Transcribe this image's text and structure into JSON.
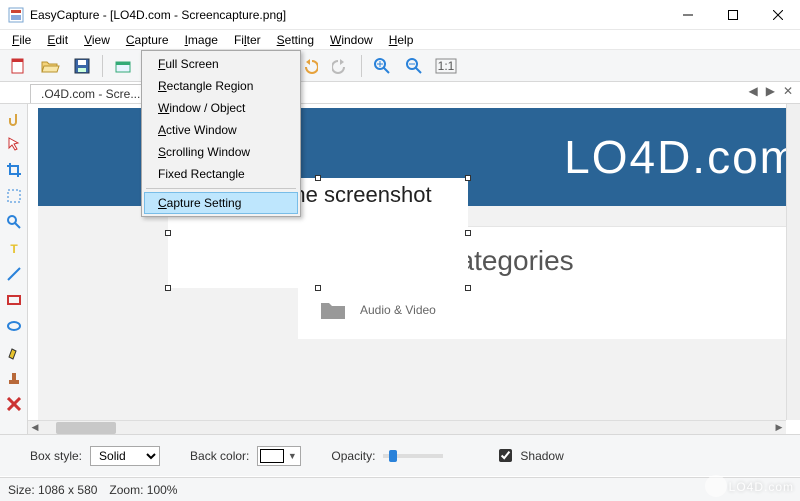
{
  "window": {
    "title": "EasyCapture - [LO4D.com - Screencapture.png]"
  },
  "menubar": [
    "File",
    "Edit",
    "View",
    "Capture",
    "Image",
    "Filter",
    "Setting",
    "Window",
    "Help"
  ],
  "dropdown": {
    "items": [
      {
        "label": "Full Screen",
        "ul": "F"
      },
      {
        "label": "Rectangle Region",
        "ul": "R"
      },
      {
        "label": "Window / Object",
        "ul": "W"
      },
      {
        "label": "Active Window",
        "ul": "A"
      },
      {
        "label": "Scrolling Window",
        "ul": "S"
      },
      {
        "label": "Fixed Rectangle",
        "ul": ""
      }
    ],
    "sep_after": 5,
    "highlighted": {
      "label": "Capture Setting",
      "ul": "C"
    }
  },
  "doc_tab": {
    "label": ".O4D.com - Scre..."
  },
  "canvas": {
    "brand_text": "LO4D.com",
    "panel_heading": "Software Categories",
    "panel_item": "Audio & Video",
    "textbox_text": "Add text to the screenshot"
  },
  "propbar": {
    "box_style_label": "Box style:",
    "box_style_value": "Solid",
    "back_color_label": "Back color:",
    "opacity_label": "Opacity:",
    "shadow_label": "Shadow",
    "shadow_checked": true
  },
  "statusbar": {
    "size_label": "Size:",
    "size_value": "1086 x 580",
    "zoom_label": "Zoom:",
    "zoom_value": "100%"
  },
  "watermark": "LO4D.com"
}
